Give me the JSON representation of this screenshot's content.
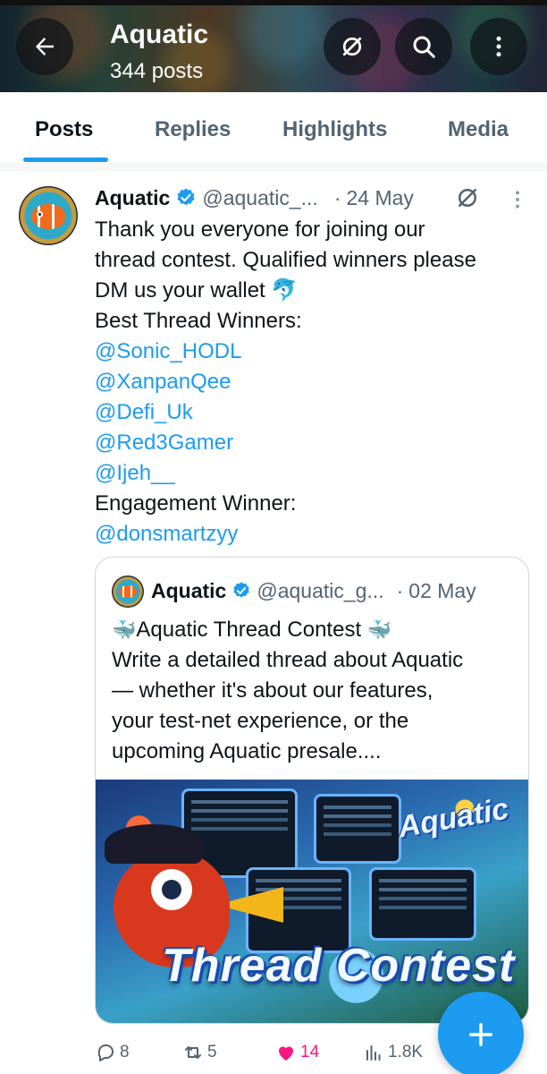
{
  "header": {
    "title": "Aquatic",
    "subtitle": "344 posts",
    "back_icon": "arrow-left-icon",
    "buttons": [
      "no-crypto-icon",
      "search-icon",
      "more-vertical-icon"
    ]
  },
  "tabs": [
    {
      "label": "Posts",
      "active": true
    },
    {
      "label": "Replies",
      "active": false
    },
    {
      "label": "Highlights",
      "active": false
    },
    {
      "label": "Media",
      "active": false
    }
  ],
  "tweet": {
    "author": "Aquatic",
    "handle": "@aquatic_...",
    "date": "24 May",
    "lines": [
      "Thank you everyone for joining our",
      "thread contest. Qualified winners please",
      "DM us your wallet 🐬",
      "Best Thread Winners:"
    ],
    "mentions": [
      "@Sonic_HODL",
      "@XanpanQee",
      "@Defi_Uk",
      "@Red3Gamer",
      "@Ijeh__"
    ],
    "engagement_label": "Engagement Winner:",
    "engagement_mention": "@donsmartzyy"
  },
  "quote": {
    "author": "Aquatic",
    "handle": "@aquatic_g...",
    "date": "02 May",
    "title": "Aquatic Thread Contest",
    "title_emoji": "🐳",
    "lines": [
      "Write a detailed thread about Aquatic",
      "— whether it's about our features,",
      "your test-net experience, or the",
      "upcoming Aquatic presale...."
    ],
    "image": {
      "brand": "Aquatic",
      "headline": "Thread Contest"
    }
  },
  "actions": {
    "replies": "8",
    "reposts": "5",
    "likes": "14",
    "views": "1.8K"
  },
  "colors": {
    "accent": "#1d9bf0",
    "like": "#f91880",
    "secondary_text": "#536471"
  }
}
